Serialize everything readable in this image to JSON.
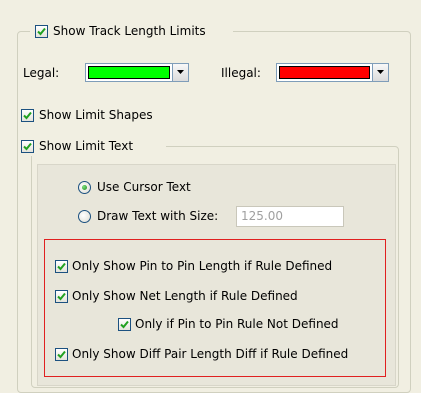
{
  "track_limits": {
    "show_label": "Show Track Length Limits",
    "show_checked": true,
    "legal_label": "Legal:",
    "legal_color": "#00ff00",
    "illegal_label": "Illegal:",
    "illegal_color": "#ff0000"
  },
  "limit_shapes": {
    "label": "Show Limit Shapes",
    "checked": true
  },
  "limit_text": {
    "label": "Show Limit Text",
    "checked": true,
    "use_cursor_label": "Use Cursor Text",
    "use_cursor_selected": true,
    "draw_text_label": "Draw Text with Size:",
    "draw_text_selected": false,
    "size_value": "125.00"
  },
  "rules": {
    "pin_to_pin_label": "Only Show Pin to Pin Length if Rule Defined",
    "net_length_label": "Only Show Net Length if Rule Defined",
    "pin_rule_not_defined_label": "Only if Pin to Pin Rule Not Defined",
    "diff_pair_label": "Only Show Diff Pair Length Diff if Rule Defined",
    "all_checked": true
  }
}
